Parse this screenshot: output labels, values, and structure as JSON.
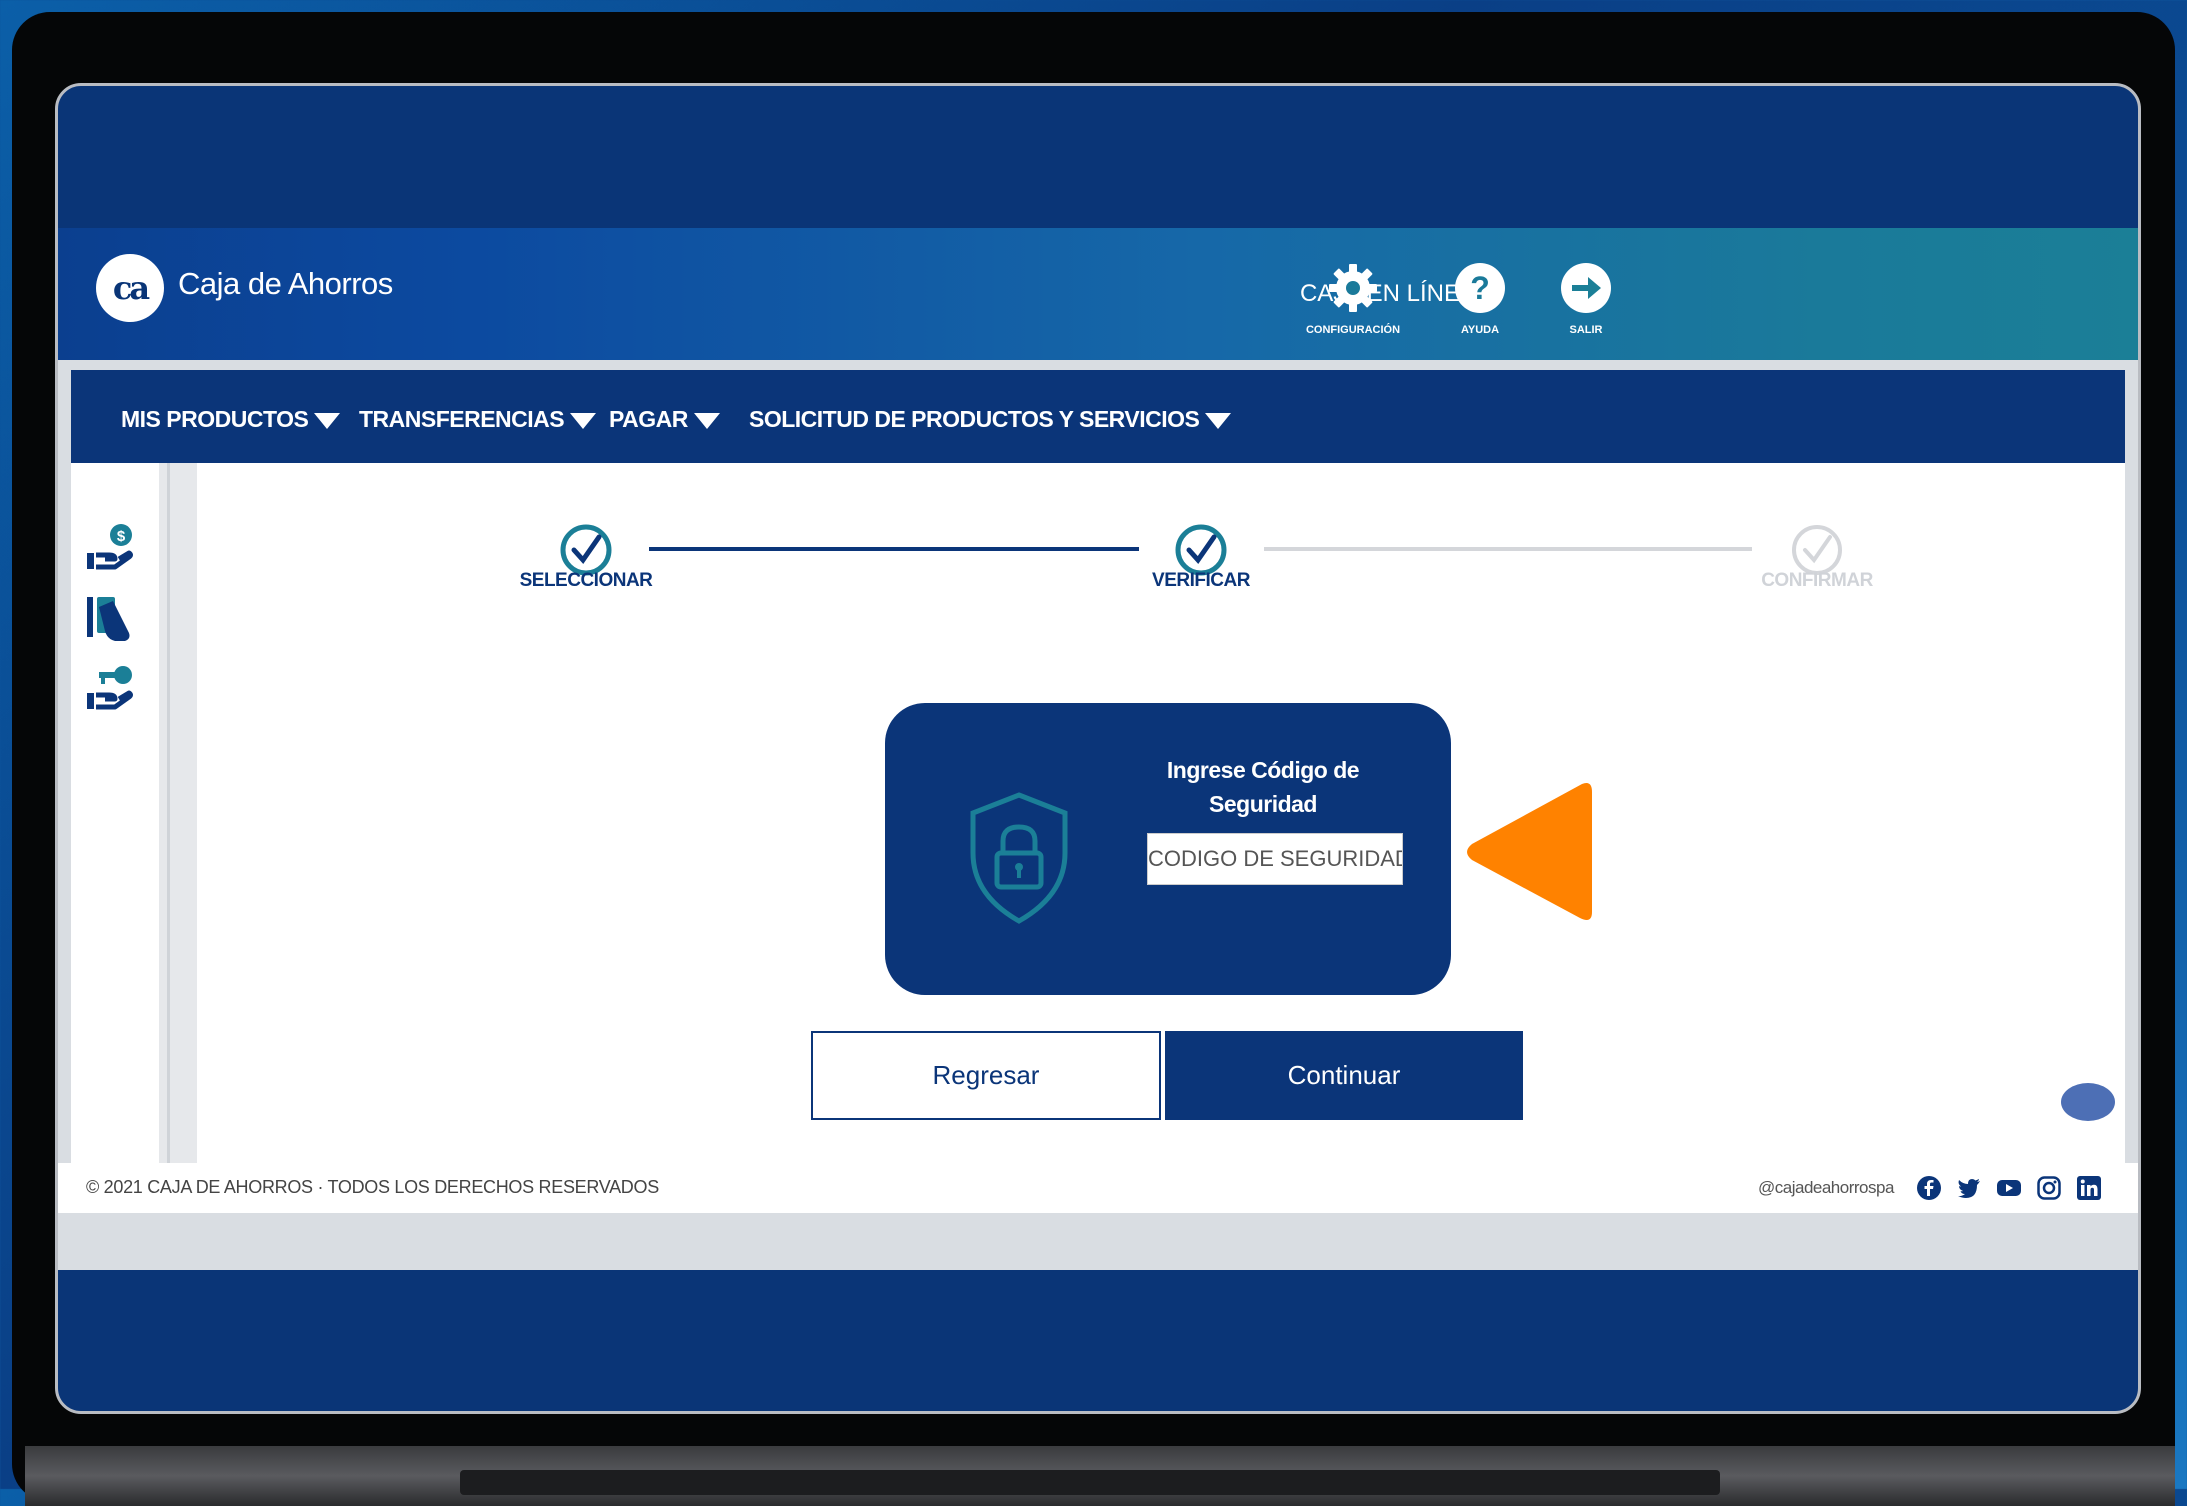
{
  "header": {
    "logo_mark": "ca",
    "brand_name": "Caja de Ahorros",
    "title": "CAJA EN LÍNEA",
    "buttons": [
      {
        "label": "CONFIGURACIÓN",
        "icon": "gear-icon"
      },
      {
        "label": "AYUDA",
        "icon": "help-icon"
      },
      {
        "label": "SALIR",
        "icon": "logout-icon"
      }
    ]
  },
  "nav": {
    "items": [
      {
        "label": "MIS PRODUCTOS"
      },
      {
        "label": "TRANSFERENCIAS"
      },
      {
        "label": "PAGAR"
      },
      {
        "label": "SOLICITUD DE PRODUCTOS Y SERVICIOS"
      }
    ]
  },
  "sidebar": {
    "icons": [
      "hand-money-icon",
      "cards-icon",
      "hand-key-icon"
    ]
  },
  "stepper": {
    "steps": [
      {
        "label": "SELECCIONAR",
        "state": "done"
      },
      {
        "label": "VERIFICAR",
        "state": "done"
      },
      {
        "label": "CONFIRMAR",
        "state": "pending"
      }
    ]
  },
  "security": {
    "title": "Ingrese Código de Seguridad",
    "input_value": "",
    "input_placeholder": "CODIGO DE SEGURIDAD"
  },
  "actions": {
    "back_label": "Regresar",
    "continue_label": "Continuar"
  },
  "footer": {
    "copyright": "© 2021 CAJA DE AHORROS · TODOS LOS DERECHOS RESERVADOS",
    "handle": "@cajadeahorrospa",
    "social": [
      "facebook-icon",
      "twitter-icon",
      "youtube-icon",
      "instagram-icon",
      "linkedin-icon"
    ]
  },
  "colors": {
    "primary": "#0b3579",
    "accent": "#ff8200",
    "teal": "#1b7f97",
    "muted": "#c9cdd2"
  }
}
